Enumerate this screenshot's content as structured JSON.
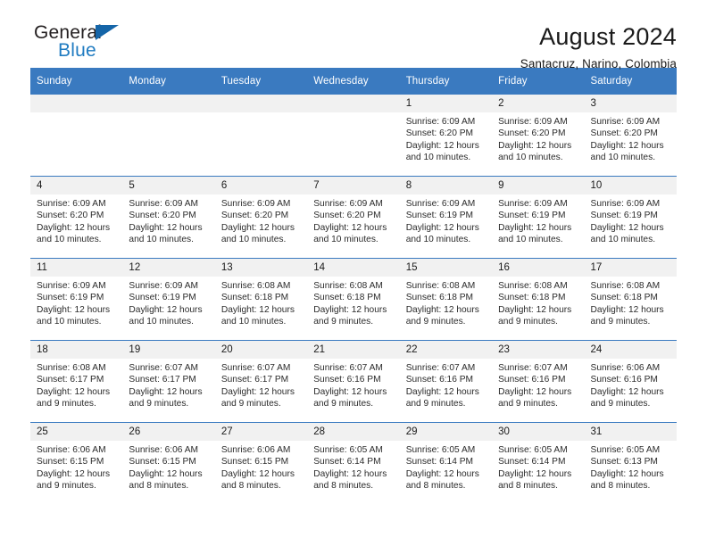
{
  "brand": {
    "name_top": "General",
    "name_bottom": "Blue",
    "mark": "triangle-logo",
    "accent_color": "#1f7bc1"
  },
  "header": {
    "title": "August 2024",
    "subtitle": "Santacruz, Narino, Colombia"
  },
  "calendar": {
    "header_bg": "#3a7ac0",
    "daynum_bg": "#f1f1f1",
    "weekdays": [
      "Sunday",
      "Monday",
      "Tuesday",
      "Wednesday",
      "Thursday",
      "Friday",
      "Saturday"
    ],
    "weeks": [
      [
        {
          "day": "",
          "sunrise": "",
          "sunset": "",
          "daylight": "",
          "daylight2": ""
        },
        {
          "day": "",
          "sunrise": "",
          "sunset": "",
          "daylight": "",
          "daylight2": ""
        },
        {
          "day": "",
          "sunrise": "",
          "sunset": "",
          "daylight": "",
          "daylight2": ""
        },
        {
          "day": "",
          "sunrise": "",
          "sunset": "",
          "daylight": "",
          "daylight2": ""
        },
        {
          "day": "1",
          "sunrise": "Sunrise: 6:09 AM",
          "sunset": "Sunset: 6:20 PM",
          "daylight": "Daylight: 12 hours",
          "daylight2": "and 10 minutes."
        },
        {
          "day": "2",
          "sunrise": "Sunrise: 6:09 AM",
          "sunset": "Sunset: 6:20 PM",
          "daylight": "Daylight: 12 hours",
          "daylight2": "and 10 minutes."
        },
        {
          "day": "3",
          "sunrise": "Sunrise: 6:09 AM",
          "sunset": "Sunset: 6:20 PM",
          "daylight": "Daylight: 12 hours",
          "daylight2": "and 10 minutes."
        }
      ],
      [
        {
          "day": "4",
          "sunrise": "Sunrise: 6:09 AM",
          "sunset": "Sunset: 6:20 PM",
          "daylight": "Daylight: 12 hours",
          "daylight2": "and 10 minutes."
        },
        {
          "day": "5",
          "sunrise": "Sunrise: 6:09 AM",
          "sunset": "Sunset: 6:20 PM",
          "daylight": "Daylight: 12 hours",
          "daylight2": "and 10 minutes."
        },
        {
          "day": "6",
          "sunrise": "Sunrise: 6:09 AM",
          "sunset": "Sunset: 6:20 PM",
          "daylight": "Daylight: 12 hours",
          "daylight2": "and 10 minutes."
        },
        {
          "day": "7",
          "sunrise": "Sunrise: 6:09 AM",
          "sunset": "Sunset: 6:20 PM",
          "daylight": "Daylight: 12 hours",
          "daylight2": "and 10 minutes."
        },
        {
          "day": "8",
          "sunrise": "Sunrise: 6:09 AM",
          "sunset": "Sunset: 6:19 PM",
          "daylight": "Daylight: 12 hours",
          "daylight2": "and 10 minutes."
        },
        {
          "day": "9",
          "sunrise": "Sunrise: 6:09 AM",
          "sunset": "Sunset: 6:19 PM",
          "daylight": "Daylight: 12 hours",
          "daylight2": "and 10 minutes."
        },
        {
          "day": "10",
          "sunrise": "Sunrise: 6:09 AM",
          "sunset": "Sunset: 6:19 PM",
          "daylight": "Daylight: 12 hours",
          "daylight2": "and 10 minutes."
        }
      ],
      [
        {
          "day": "11",
          "sunrise": "Sunrise: 6:09 AM",
          "sunset": "Sunset: 6:19 PM",
          "daylight": "Daylight: 12 hours",
          "daylight2": "and 10 minutes."
        },
        {
          "day": "12",
          "sunrise": "Sunrise: 6:09 AM",
          "sunset": "Sunset: 6:19 PM",
          "daylight": "Daylight: 12 hours",
          "daylight2": "and 10 minutes."
        },
        {
          "day": "13",
          "sunrise": "Sunrise: 6:08 AM",
          "sunset": "Sunset: 6:18 PM",
          "daylight": "Daylight: 12 hours",
          "daylight2": "and 10 minutes."
        },
        {
          "day": "14",
          "sunrise": "Sunrise: 6:08 AM",
          "sunset": "Sunset: 6:18 PM",
          "daylight": "Daylight: 12 hours",
          "daylight2": "and 9 minutes."
        },
        {
          "day": "15",
          "sunrise": "Sunrise: 6:08 AM",
          "sunset": "Sunset: 6:18 PM",
          "daylight": "Daylight: 12 hours",
          "daylight2": "and 9 minutes."
        },
        {
          "day": "16",
          "sunrise": "Sunrise: 6:08 AM",
          "sunset": "Sunset: 6:18 PM",
          "daylight": "Daylight: 12 hours",
          "daylight2": "and 9 minutes."
        },
        {
          "day": "17",
          "sunrise": "Sunrise: 6:08 AM",
          "sunset": "Sunset: 6:18 PM",
          "daylight": "Daylight: 12 hours",
          "daylight2": "and 9 minutes."
        }
      ],
      [
        {
          "day": "18",
          "sunrise": "Sunrise: 6:08 AM",
          "sunset": "Sunset: 6:17 PM",
          "daylight": "Daylight: 12 hours",
          "daylight2": "and 9 minutes."
        },
        {
          "day": "19",
          "sunrise": "Sunrise: 6:07 AM",
          "sunset": "Sunset: 6:17 PM",
          "daylight": "Daylight: 12 hours",
          "daylight2": "and 9 minutes."
        },
        {
          "day": "20",
          "sunrise": "Sunrise: 6:07 AM",
          "sunset": "Sunset: 6:17 PM",
          "daylight": "Daylight: 12 hours",
          "daylight2": "and 9 minutes."
        },
        {
          "day": "21",
          "sunrise": "Sunrise: 6:07 AM",
          "sunset": "Sunset: 6:16 PM",
          "daylight": "Daylight: 12 hours",
          "daylight2": "and 9 minutes."
        },
        {
          "day": "22",
          "sunrise": "Sunrise: 6:07 AM",
          "sunset": "Sunset: 6:16 PM",
          "daylight": "Daylight: 12 hours",
          "daylight2": "and 9 minutes."
        },
        {
          "day": "23",
          "sunrise": "Sunrise: 6:07 AM",
          "sunset": "Sunset: 6:16 PM",
          "daylight": "Daylight: 12 hours",
          "daylight2": "and 9 minutes."
        },
        {
          "day": "24",
          "sunrise": "Sunrise: 6:06 AM",
          "sunset": "Sunset: 6:16 PM",
          "daylight": "Daylight: 12 hours",
          "daylight2": "and 9 minutes."
        }
      ],
      [
        {
          "day": "25",
          "sunrise": "Sunrise: 6:06 AM",
          "sunset": "Sunset: 6:15 PM",
          "daylight": "Daylight: 12 hours",
          "daylight2": "and 9 minutes."
        },
        {
          "day": "26",
          "sunrise": "Sunrise: 6:06 AM",
          "sunset": "Sunset: 6:15 PM",
          "daylight": "Daylight: 12 hours",
          "daylight2": "and 8 minutes."
        },
        {
          "day": "27",
          "sunrise": "Sunrise: 6:06 AM",
          "sunset": "Sunset: 6:15 PM",
          "daylight": "Daylight: 12 hours",
          "daylight2": "and 8 minutes."
        },
        {
          "day": "28",
          "sunrise": "Sunrise: 6:05 AM",
          "sunset": "Sunset: 6:14 PM",
          "daylight": "Daylight: 12 hours",
          "daylight2": "and 8 minutes."
        },
        {
          "day": "29",
          "sunrise": "Sunrise: 6:05 AM",
          "sunset": "Sunset: 6:14 PM",
          "daylight": "Daylight: 12 hours",
          "daylight2": "and 8 minutes."
        },
        {
          "day": "30",
          "sunrise": "Sunrise: 6:05 AM",
          "sunset": "Sunset: 6:14 PM",
          "daylight": "Daylight: 12 hours",
          "daylight2": "and 8 minutes."
        },
        {
          "day": "31",
          "sunrise": "Sunrise: 6:05 AM",
          "sunset": "Sunset: 6:13 PM",
          "daylight": "Daylight: 12 hours",
          "daylight2": "and 8 minutes."
        }
      ]
    ]
  }
}
